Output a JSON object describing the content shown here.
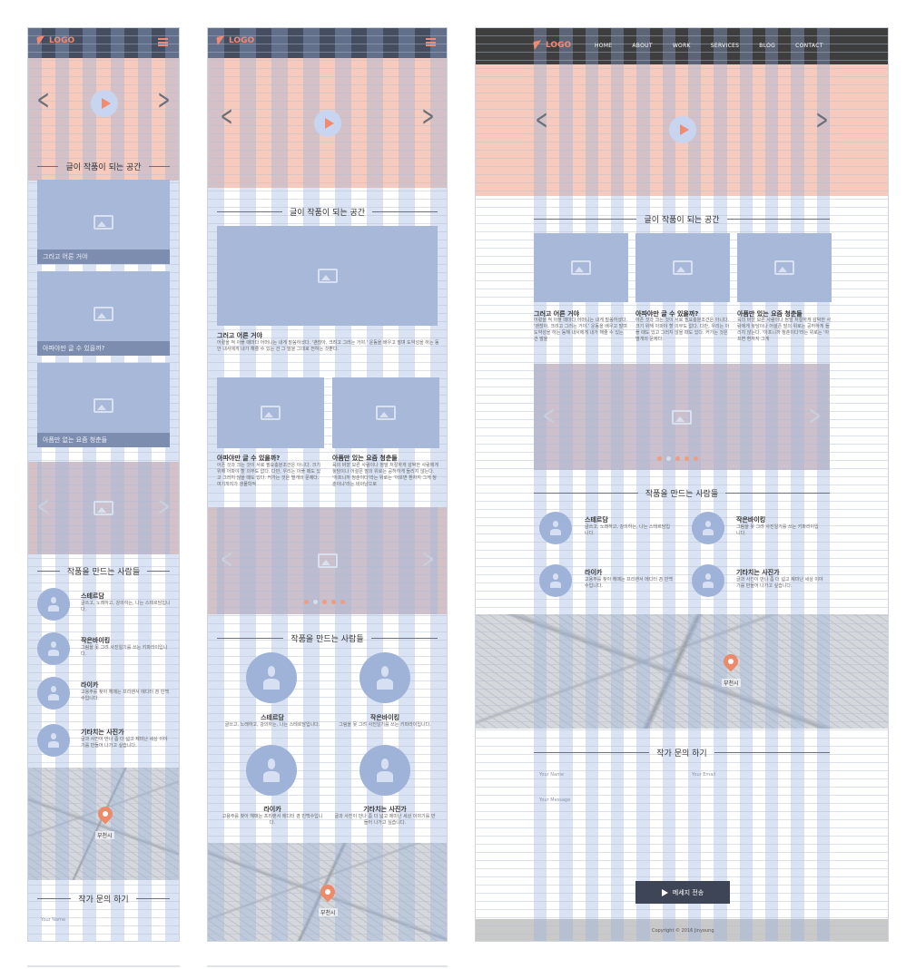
{
  "logo_text": "LOGO",
  "nav": [
    "HOME",
    "ABOUT",
    "WORK",
    "SERVICES",
    "BLOG",
    "CONTACT"
  ],
  "sections": {
    "writing": "글이 작품이 되는 공간",
    "makers": "작품을 만드는 사람들",
    "contact": "작가 문의 하기"
  },
  "posts": [
    {
      "title": "그러고 어른 거야",
      "text": "어렸을 적 아플 때마다 어머니는 내게 말씀하셨다. '괜찮아, 크려고 그러는 거야.' 운동을 배우고 말며 도약성을 하는 동안 내서에게 내가 해줄 수 있는 건 그 말을 그대로 전하는 것뿐다.",
      "text_short": "어렸을 적 아플 때마다 어머니는 내게 말씀하셨다. '괜찮아, 크려고 그러는 거야.' 운동을 배우고 말며 도약성을 하는 동해 내서에게 내가 해줄 수 있는 건 말을"
    },
    {
      "title": "아파야만 글 수 있을까?",
      "text": "아픈 것과 크는 것이 서로 필요충분조건은 아니다. 크기 위해 아파야 할 의무도 없다. 다만, 우리는 아플 때도 있고 그러지 않을 때도 있다. 커가는 것은 별개의 문제다. 여기까지가 생물학적",
      "text_short": "아픈 것과 크는 것이 서로 필요충분조건은 아니다. 크기 위해 아파야 할 의무도 없다. 다만, 우리는 아플 때도 있고 그러지 않을 때도 있다. 커가는 것은 별개의 문제다."
    },
    {
      "title": "아픔만 있는 요즘 청춘들",
      "text": "육의 바깥 모른 사람이나 정말 처절하게 감박한 사람에게 놓담이나 어설픈 말의 위로는 공허하게 들리지 않는다. '아프니까 청춘이다'라는 위로는 '아프면 환자지 그게 청춘이냐'라는 비아냥으로",
      "text_short": "육의 바깥 모른 사람이나 정말 처절하게 감박한 사람에게 놓담이나 어설픈 말의 위로는 공허하게 들리지 않는다. '아프니까 청춘이다'라는 위로는 '아프면 환자지 그게"
    }
  ],
  "captions": [
    "그러고 어른 거야",
    "아파야만 글 수 있을까?",
    "아픔만 없는 요즘 청춘들"
  ],
  "people": [
    {
      "name": "스테르담",
      "desc": "글쓰고, 노래하고, 강의하는, 나는 스테르담입니다."
    },
    {
      "name": "작은바이킹",
      "desc": "그림을 못 그려 사진일기를 쓰는 키파라이입니다."
    },
    {
      "name": "라이카",
      "desc": "고용주를 찾아 헤매는 프리랜서 에디터 겸 빈백수입니다."
    },
    {
      "name": "기타치는 사진가",
      "desc": "글과 사진이 만나 좀 더 넓고 제미난 세상 이야기를 만들어 나가고 싶습니다."
    }
  ],
  "map_label": "부천시",
  "form": {
    "name": "Your Name",
    "email": "Your Email",
    "message": "Your Message",
    "send": "메세지 전송"
  },
  "footer": "Copyright © 2016 Jinyoung"
}
